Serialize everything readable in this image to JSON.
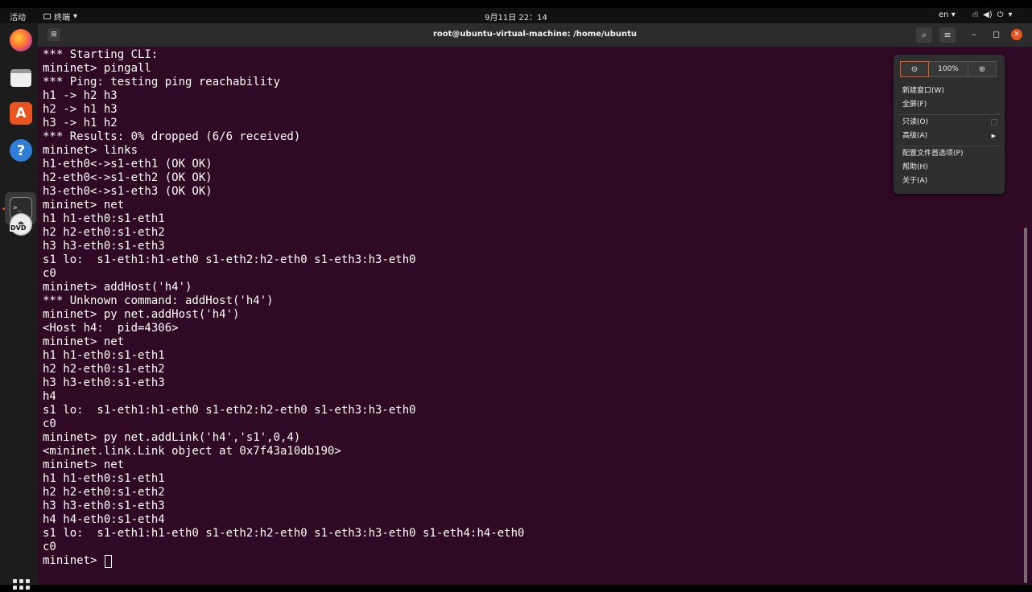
{
  "topbar": {
    "activities": "活动",
    "app_name": "终端",
    "clock": "9月11日  22：14",
    "language": "en"
  },
  "dock": {
    "apps": [
      "firefox-icon",
      "files-icon",
      "software-store-icon",
      "help-icon",
      "terminal-icon",
      "dvd-icon"
    ],
    "dvd_label": "DVD",
    "terminal_label": ">_",
    "help_label": "?",
    "store_label": "A"
  },
  "window": {
    "title": "root@ubuntu-virtual-machine: /home/ubuntu"
  },
  "terminal": {
    "lines": [
      "*** Starting CLI:",
      "mininet> pingall",
      "*** Ping: testing ping reachability",
      "h1 -> h2 h3",
      "h2 -> h1 h3",
      "h3 -> h1 h2",
      "*** Results: 0% dropped (6/6 received)",
      "mininet> links",
      "h1-eth0<->s1-eth1 (OK OK)",
      "h2-eth0<->s1-eth2 (OK OK)",
      "h3-eth0<->s1-eth3 (OK OK)",
      "mininet> net",
      "h1 h1-eth0:s1-eth1",
      "h2 h2-eth0:s1-eth2",
      "h3 h3-eth0:s1-eth3",
      "s1 lo:  s1-eth1:h1-eth0 s1-eth2:h2-eth0 s1-eth3:h3-eth0",
      "c0",
      "mininet> addHost('h4')",
      "*** Unknown command: addHost('h4')",
      "mininet> py net.addHost('h4')",
      "<Host h4:  pid=4306>",
      "mininet> net",
      "h1 h1-eth0:s1-eth1",
      "h2 h2-eth0:s1-eth2",
      "h3 h3-eth0:s1-eth3",
      "h4",
      "s1 lo:  s1-eth1:h1-eth0 s1-eth2:h2-eth0 s1-eth3:h3-eth0",
      "c0",
      "mininet> py net.addLink('h4','s1',0,4)",
      "<mininet.link.Link object at 0x7f43a10db190>",
      "mininet> net",
      "h1 h1-eth0:s1-eth1",
      "h2 h2-eth0:s1-eth2",
      "h3 h3-eth0:s1-eth3",
      "h4 h4-eth0:s1-eth4",
      "s1 lo:  s1-eth1:h1-eth0 s1-eth2:h2-eth0 s1-eth3:h3-eth0 s1-eth4:h4-eth0",
      "c0"
    ],
    "prompt": "mininet> "
  },
  "menu": {
    "zoom_level": "100%",
    "new_window": "新建窗口(W)",
    "fullscreen": "全屏(F)",
    "read_only": "只读(O)",
    "advanced": "高级(A)",
    "preferences": "配置文件首选项(P)",
    "help": "帮助(H)",
    "about": "关于(A)"
  },
  "colors": {
    "terminal_bg": "#300a24",
    "accent": "#e95420",
    "titlebar": "#2c2c2c"
  }
}
